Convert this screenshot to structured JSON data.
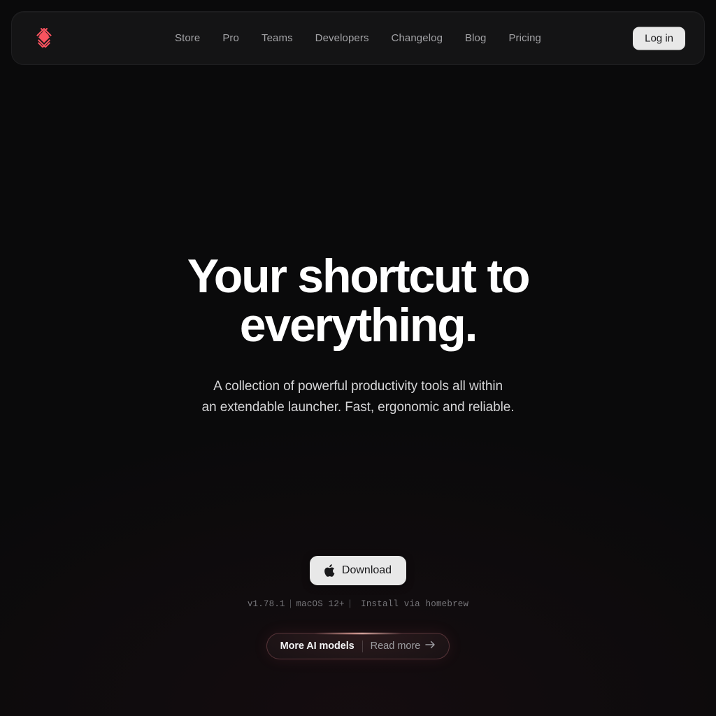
{
  "brand": {
    "logo_icon": "raycast-diamond-logo",
    "accent_color": "#f9535f"
  },
  "nav": {
    "items": [
      {
        "label": "Store"
      },
      {
        "label": "Pro"
      },
      {
        "label": "Teams"
      },
      {
        "label": "Developers"
      },
      {
        "label": "Changelog"
      },
      {
        "label": "Blog"
      },
      {
        "label": "Pricing"
      }
    ],
    "login_label": "Log in"
  },
  "hero": {
    "title": "Your shortcut to everything.",
    "subtitle_line1": "A collection of powerful productivity tools all within",
    "subtitle_line2": "an extendable launcher. Fast, ergonomic and reliable."
  },
  "download": {
    "icon": "apple-icon",
    "label": "Download",
    "version": "v1.78.1",
    "os": "macOS 12+",
    "alt_install": "Install via homebrew",
    "separator": "|"
  },
  "promo_pill": {
    "title": "More AI models",
    "link_label": "Read more",
    "arrow_icon": "arrow-right-icon",
    "border_color": "#e2818c"
  }
}
